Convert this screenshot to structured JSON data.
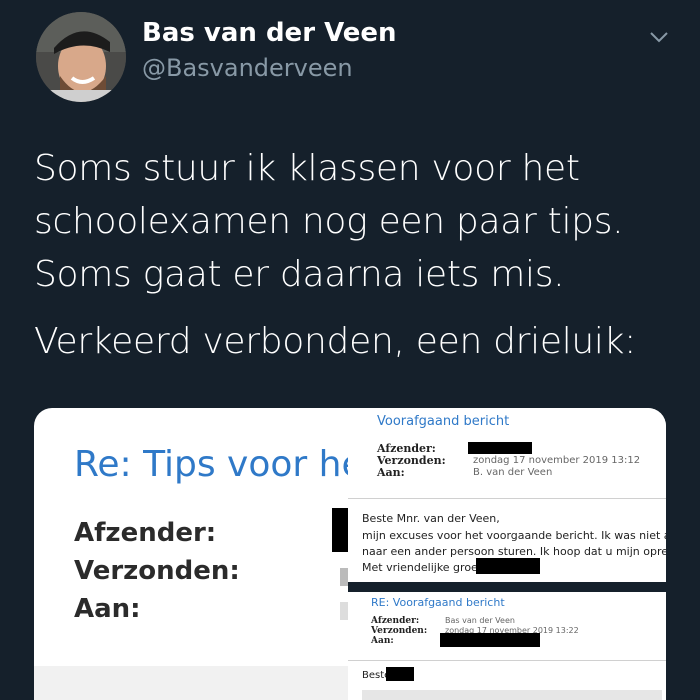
{
  "author": {
    "name": "Bas van der Veen",
    "handle": "@Basvanderveen"
  },
  "icons": {
    "menu": "chevron-down-icon",
    "avatar": "profile-photo"
  },
  "tweet": {
    "paragraph1": "Soms stuur ik klassen voor het schoolexamen nog een paar tips. Soms gaat er daarna iets mis.",
    "paragraph2": "Verkeerd verbonden, een drieluik:"
  },
  "media": {
    "left": {
      "subject": "Re: Tips voor he",
      "labels": [
        "Afzender:",
        "Verzonden:",
        "Aan:"
      ]
    },
    "right_top": {
      "title": "Voorafgaand bericht",
      "labels": [
        "Afzender:",
        "Verzonden:",
        "Aan:"
      ],
      "sent": "zondag 17 november 2019 13:12",
      "to": "B. van der Veen",
      "body": [
        "Beste Mnr. van der Veen,",
        "mijn excuses voor het voorgaande bericht. Ik was niet aan h",
        "naar een ander persoon sturen. Ik hoop dat u mijn oprechte",
        "Met vriendelijke groet"
      ]
    },
    "right_bottom": {
      "title": "RE: Voorafgaand bericht",
      "labels": [
        "Afzender:",
        "Verzonden:",
        "Aan:"
      ],
      "from": "Bas van der Veen",
      "sent": "zondag 17 november 2019 13:22",
      "greeting": "Beste"
    }
  },
  "colors": {
    "background": "#15202b",
    "secondary_text": "#8899a6",
    "email_link_blue": "#2f79c8"
  }
}
